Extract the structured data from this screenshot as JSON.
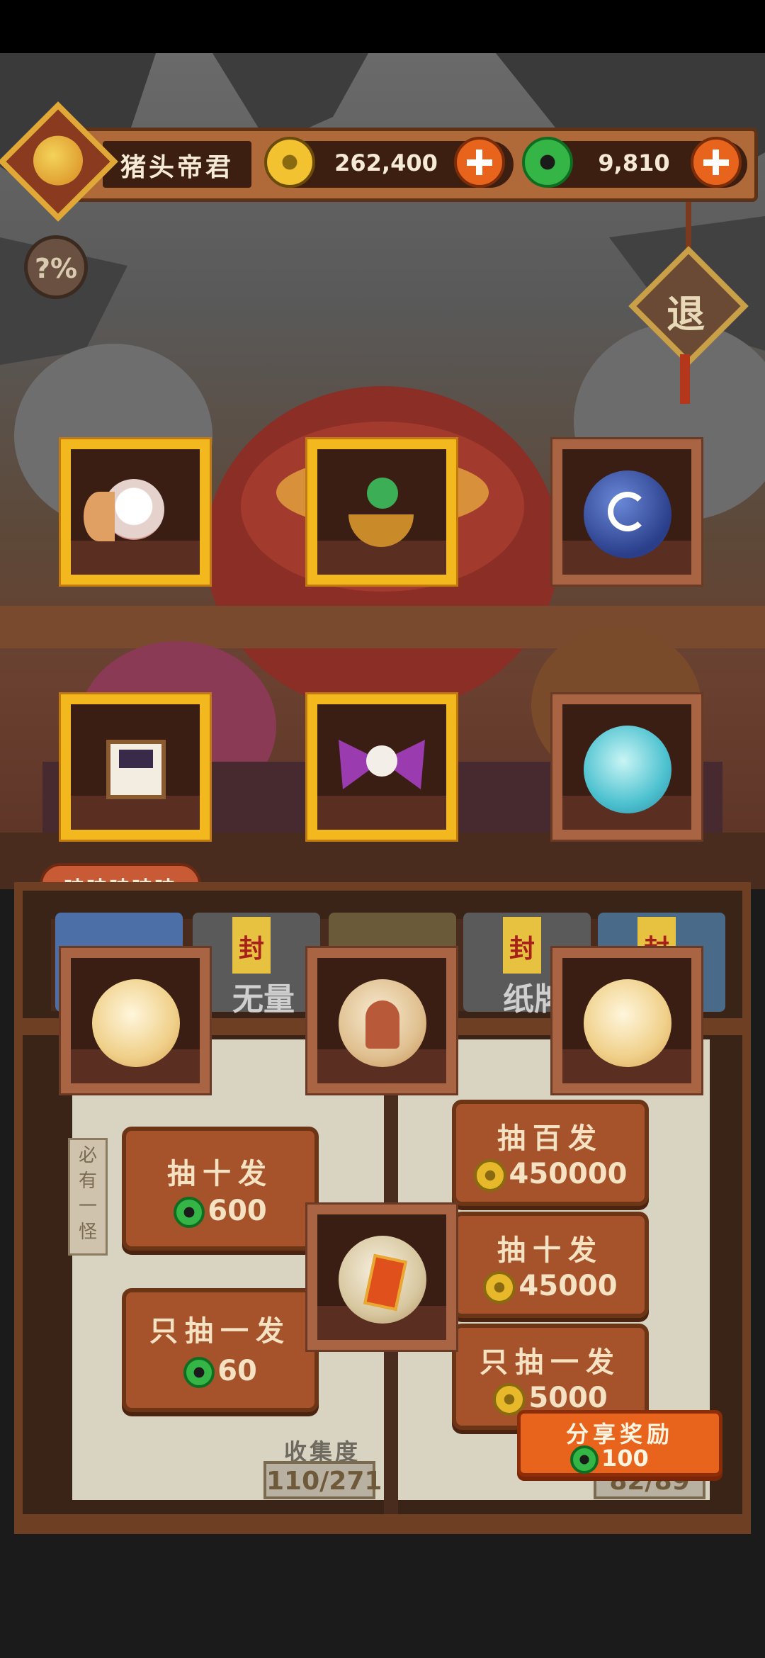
{
  "player": {
    "name": "猪头帝君"
  },
  "currency": {
    "gold": "262,400",
    "jade": "9,810",
    "colors": {
      "gold": "#f2c230",
      "jade": "#34b545",
      "plus": "#e8641c"
    }
  },
  "buttons": {
    "exit": "退",
    "odds": "?%",
    "speech_tag": "哇哇哇哇哇",
    "wall_sign": "必有一怪",
    "share_label": "分享奖励",
    "share_reward": "100"
  },
  "shelf_items": [
    {
      "icon": "pig-fan-figure-icon",
      "frame": "gold"
    },
    {
      "icon": "snake-pot-icon",
      "frame": "gold"
    },
    {
      "icon": "blue-orb-c-icon",
      "frame": "wood"
    },
    {
      "icon": "treasure-chest-icon",
      "frame": "gold"
    },
    {
      "icon": "purple-bow-icon",
      "frame": "gold"
    },
    {
      "icon": "crystal-orb-icon",
      "frame": "wood"
    }
  ],
  "tabs": [
    {
      "label": "无量",
      "seal": "封"
    },
    {
      "label": "",
      "seal": ""
    },
    {
      "label": "纸牌",
      "seal": "封"
    },
    {
      "label": "",
      "seal": "封"
    }
  ],
  "gacha_left": {
    "ten": {
      "label": "抽十发",
      "price": "600"
    },
    "one": {
      "label": "只抽一发",
      "price": "60"
    },
    "collection_label": "收集度",
    "collection_value": "110/271"
  },
  "gacha_right": {
    "hundred": {
      "label": "抽百发",
      "price": "450000"
    },
    "ten": {
      "label": "抽十发",
      "price": "45000"
    },
    "one": {
      "label": "只抽一发",
      "price": "5000"
    },
    "collection_value": "82/89"
  },
  "reward_items": [
    {
      "icon": "golden-fish-orb-icon"
    },
    {
      "icon": "monk-figure-orb-icon"
    },
    {
      "icon": "golden-fish-orb-icon"
    },
    {
      "icon": "fire-gem-orb-icon"
    }
  ]
}
